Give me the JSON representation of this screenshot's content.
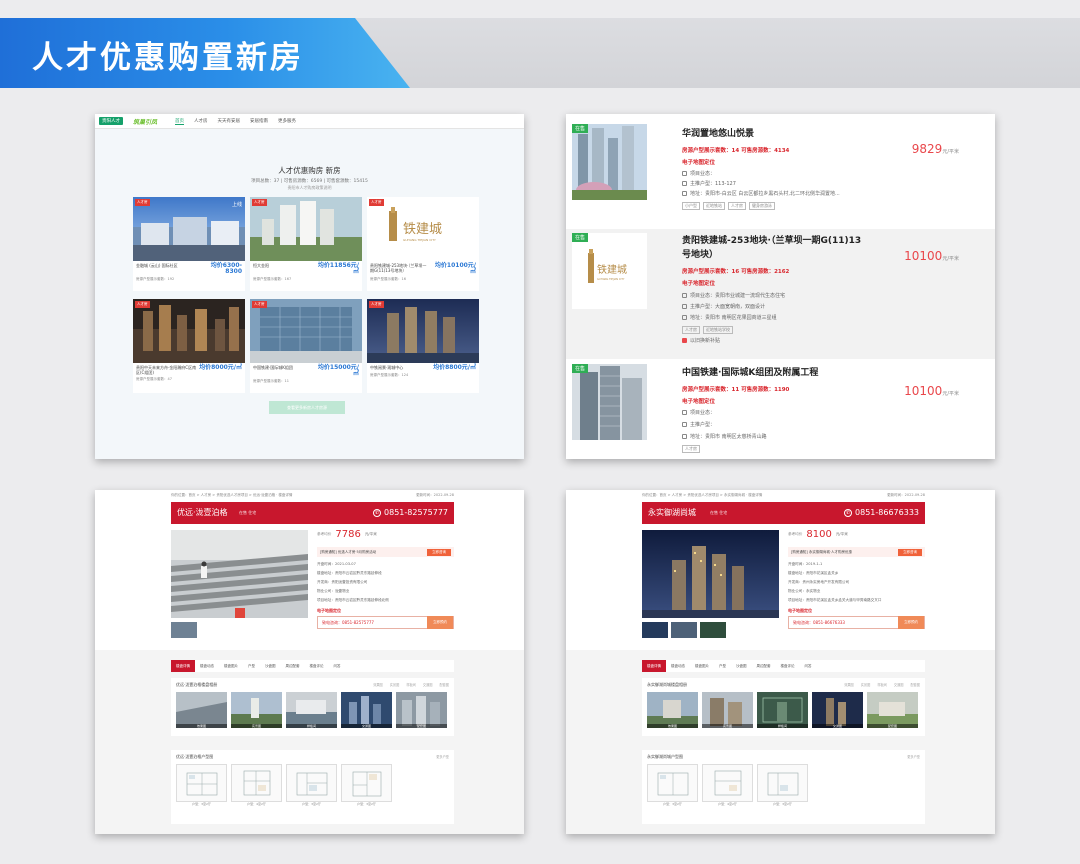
{
  "banner": {
    "title": "人才优惠购置新房"
  },
  "panel1": {
    "nav": {
      "badge": "贵阳人才",
      "brand": "筑巢引凤",
      "items": [
        "首页",
        "人才房",
        "天天有安居",
        "安居指南",
        "更多服务"
      ]
    },
    "title": "人才优惠购房 新房",
    "subtitle": "项目总数：37 | 可售房源数：6569 | 可售套源数：15415",
    "subtitle2": "贵阳市人才购房政策说明",
    "cards": [
      {
        "tag": "人才房",
        "onsale": "上线",
        "name": "金融城 (云山) 国际社区",
        "price": "均价6300-8300",
        "sub": "房源户型展示套数：192"
      },
      {
        "tag": "人才房",
        "onsale": "",
        "name": "恒大金阳",
        "price": "均价11856元/㎡",
        "sub": "房源户型展示套数：167"
      },
      {
        "tag": "人才房",
        "onsale": "",
        "name": "贵阳铁建城-253地块·（兰草坝一期G(11)13号地块）",
        "price": "均价10100元/㎡",
        "sub": "房源户型展示套数：16"
      },
      {
        "tag": "人才房",
        "onsale": "",
        "name": "贵阳中天未来方舟·金阳瀚府C区南区(C组团)",
        "price": "均价8000元/㎡",
        "sub": "房源户型展示套数：47"
      },
      {
        "tag": "人才房",
        "onsale": "",
        "name": "中国铁建·国际城K组团",
        "price": "均价15000元/㎡",
        "sub": "房源户型展示套数：11"
      },
      {
        "tag": "人才房",
        "onsale": "",
        "name": "中铁阅景·观城中心",
        "price": "均价8800元/㎡",
        "sub": "房源户型展示套数：124"
      }
    ],
    "more_button": "查看更多新房人才房源"
  },
  "panel2": {
    "items": [
      {
        "tag": "在售",
        "title": "华润置地悠山悦景",
        "count": "房源户型展示套数：14   可售房源数：4134",
        "map": "电子地图定位",
        "lines": [
          "项目业态：",
          "主推户型：113-127",
          "地址：贵阳市-白云区 白云区都拉乡黑石头村,北二环北侧华润置地..."
        ],
        "tags": [
          "小户型",
          "近地铁站",
          "人才房",
          "健身房游泳"
        ],
        "price": "9829",
        "unit": "元/平米"
      },
      {
        "tag": "在售",
        "title": "贵阳铁建城-253地块·（兰草坝一期G(11)13号地块）",
        "count": "房源户型展示套数：16   可售房源数：2162",
        "map": "电子地图定位",
        "lines": [
          "项目业态：贵阳市业城建一流现代生态住宅",
          "主推户型：大面宽朝南，双面设计",
          "地址：贵阳市 南明区花果园商道三星组"
        ],
        "tags": [
          "人才房",
          "近地铁站学校"
        ],
        "note": "以旧换新补贴",
        "price": "10100",
        "unit": "元/平米"
      },
      {
        "tag": "在售",
        "title": "中国铁建·国际城K组团及附属工程",
        "count": "房源户型展示套数：11   可售房源数：1190",
        "map": "电子地图定位",
        "lines": [
          "项目业态：",
          "主推户型：",
          "地址：贵阳市 南明区太慈桥青山路"
        ],
        "tags": [
          "人才房"
        ],
        "price": "10100",
        "unit": "元/平米"
      }
    ]
  },
  "panel3": {
    "crumb": "你的位置：首页 > 人才房 > 贵阳优选人才房项目 > 优远·泷壹泊格 · 楼盘详情",
    "crumb_right": "更新时间：2022-09-28",
    "name": "优远·泷壹泊格",
    "meta": "在售   住宅",
    "phone": "0851-82575777",
    "price": "7786",
    "price_unit": "元/平米",
    "lines": [
      "开盘时间：2021-03-07",
      "楼盘地址：贵阳市云岩区黔灵东路延伸段",
      "开发商：贵阳泷壹投资有限公司",
      "物业公司：泷壹物业",
      "项目地址：贵阳市云岩区黔灵东路延伸段北侧"
    ],
    "notice": "[购房通知] 优选人才房·5月购房活动",
    "notice_btn": "立即咨询",
    "dial": "致电咨询：0851-82575777",
    "dial_btn": "立即预约",
    "map": "电子地图定位",
    "tabs": [
      "楼盘详情",
      "楼盘动态",
      "楼盘图片",
      "户型",
      "沙盘图",
      "周边配套",
      "楼盘评论",
      "问答"
    ],
    "section1": {
      "title": "优远·泷壹泊格楼盘相册",
      "tabs": [
        "效果图",
        "实景图",
        "样板间",
        "交通图",
        "配套图"
      ],
      "photos": [
        "效果图",
        "实景图",
        "样板间",
        "交通图",
        "配套图"
      ]
    },
    "section2": {
      "title": "优远·泷壹泊格户型图",
      "more": "更多户型",
      "plans": [
        "户型：3室2厅",
        "户型：4室2厅",
        "户型：3室2厅",
        "户型：3室2厅"
      ]
    }
  },
  "panel4": {
    "crumb": "你的位置：首页 > 人才房 > 贵阳优选人才房项目 > 永实御湖尚城 · 楼盘详情",
    "crumb_right": "更新时间：2022-09-28",
    "name": "永实御湖尚城",
    "meta": "在售   住宅",
    "phone": "0851-86676333",
    "price": "8100",
    "price_unit": "元/平米",
    "lines": [
      "开盘时间：2019-1-1",
      "楼盘地址：贵阳市花溪区孟关乡",
      "开发商：贵州永实房地产开发有限公司",
      "物业公司：永实物业",
      "项目地址：贵阳市花溪区孟关乡孟关大道与甲秀南路交叉口"
    ],
    "notice": "[购房通知] 永实御湖尚城·人才购房优惠",
    "notice_btn": "立即咨询",
    "dial": "致电咨询：0851-86676333",
    "dial_btn": "立即预约",
    "map": "电子地图定位",
    "tabs": [
      "楼盘详情",
      "楼盘动态",
      "楼盘图片",
      "户型",
      "沙盘图",
      "周边配套",
      "楼盘评论",
      "问答"
    ],
    "section1": {
      "title": "永实御湖尚城楼盘相册",
      "tabs": [
        "效果图",
        "实景图",
        "样板间",
        "交通图",
        "配套图"
      ],
      "photos": [
        "效果图",
        "实景图",
        "样板间",
        "交通图",
        "配套图"
      ]
    },
    "section2": {
      "title": "永实御湖尚城户型图",
      "more": "更多户型",
      "plans": [
        "户型：3室2厅",
        "户型：4室2厅",
        "户型：3室2厅"
      ]
    }
  }
}
